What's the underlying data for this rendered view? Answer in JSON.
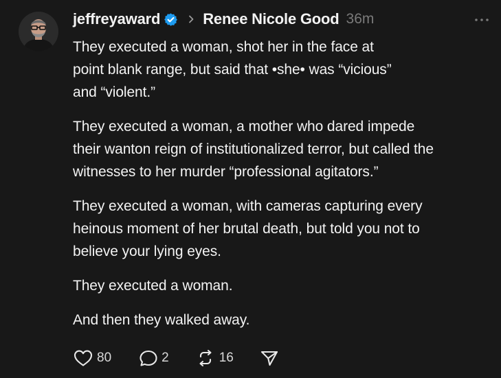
{
  "post": {
    "author": "jeffreyaward",
    "topic": "Renee Nicole Good",
    "time": "36m",
    "paragraphs": [
      "They executed a woman, shot her in the face at\npoint blank range, but said that •she• was “vicious”\nand “violent.”",
      "They executed a woman, a mother who dared impede\ntheir wanton reign of institutionalized terror, but called the\nwitnesses to her murder “professional agitators.”",
      "They executed a woman, with cameras capturing every\nheinous moment of her brutal death, but told you not to\nbelieve your lying eyes.",
      "They executed a woman.",
      "And then they walked away."
    ]
  },
  "actions": {
    "likes": "80",
    "replies": "2",
    "reposts": "16"
  },
  "icons": {
    "verified": "verified-badge-icon",
    "chevron": "chevron-right-icon",
    "more": "more-options-icon",
    "like": "heart-icon",
    "reply": "comment-icon",
    "repost": "repost-icon",
    "share": "send-icon"
  },
  "colors": {
    "background": "#181818",
    "text": "#f3f3f3",
    "muted": "#7a7a7a",
    "verified": "#1d9bf0"
  }
}
